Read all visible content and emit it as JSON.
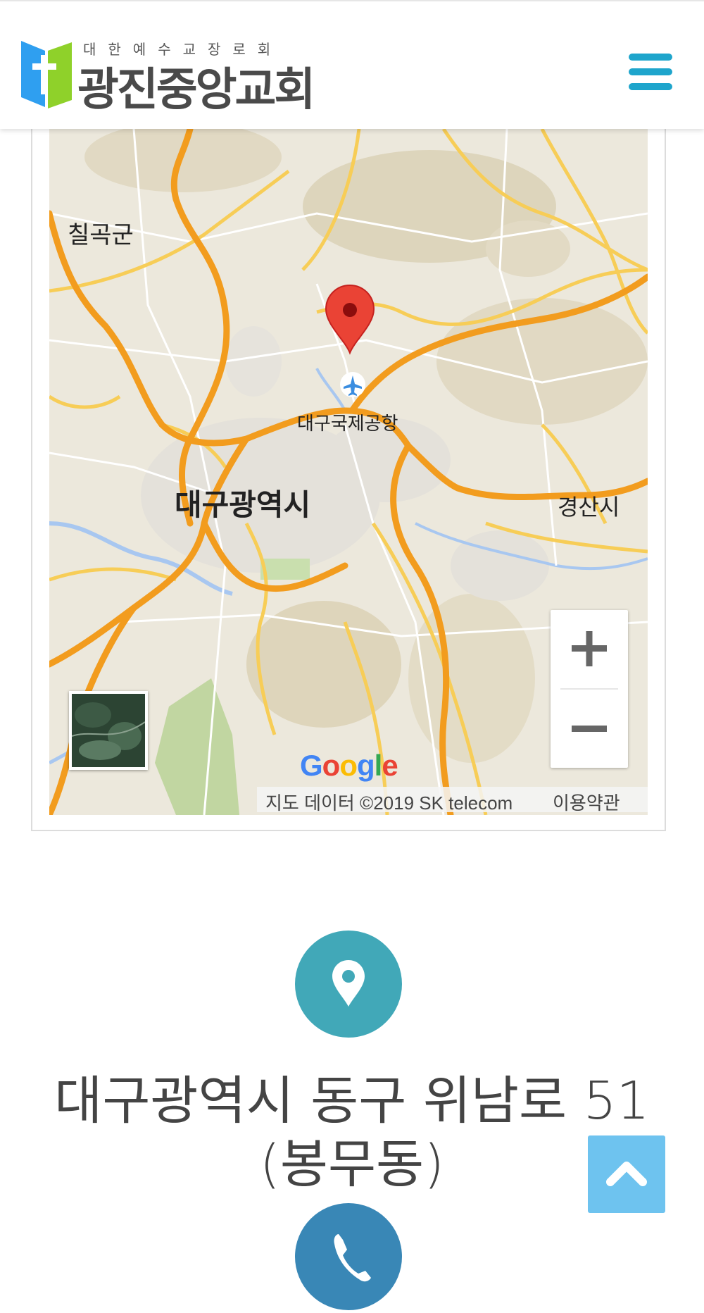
{
  "header": {
    "logo_subtitle": "대한예수교장로회",
    "logo_title": "광진중앙교회",
    "menu_icon": "hamburger-menu-icon",
    "accent_color": "#1ea5cc"
  },
  "map": {
    "labels": {
      "chilgok": "칠곡군",
      "airport": "대구국제공항",
      "daegu": "대구광역시",
      "gyeongsan": "경산시"
    },
    "google_logo": "Google",
    "attribution": "지도 데이터 ©2019 SK telecom",
    "terms": "이용약관",
    "zoom_in": "+",
    "zoom_out": "−"
  },
  "contact": {
    "address": "대구광역시 동구 위남로 51 (봉무동)",
    "location_icon": "map-pin-icon",
    "phone_icon": "phone-icon"
  },
  "scroll_top_icon": "chevron-up-icon"
}
